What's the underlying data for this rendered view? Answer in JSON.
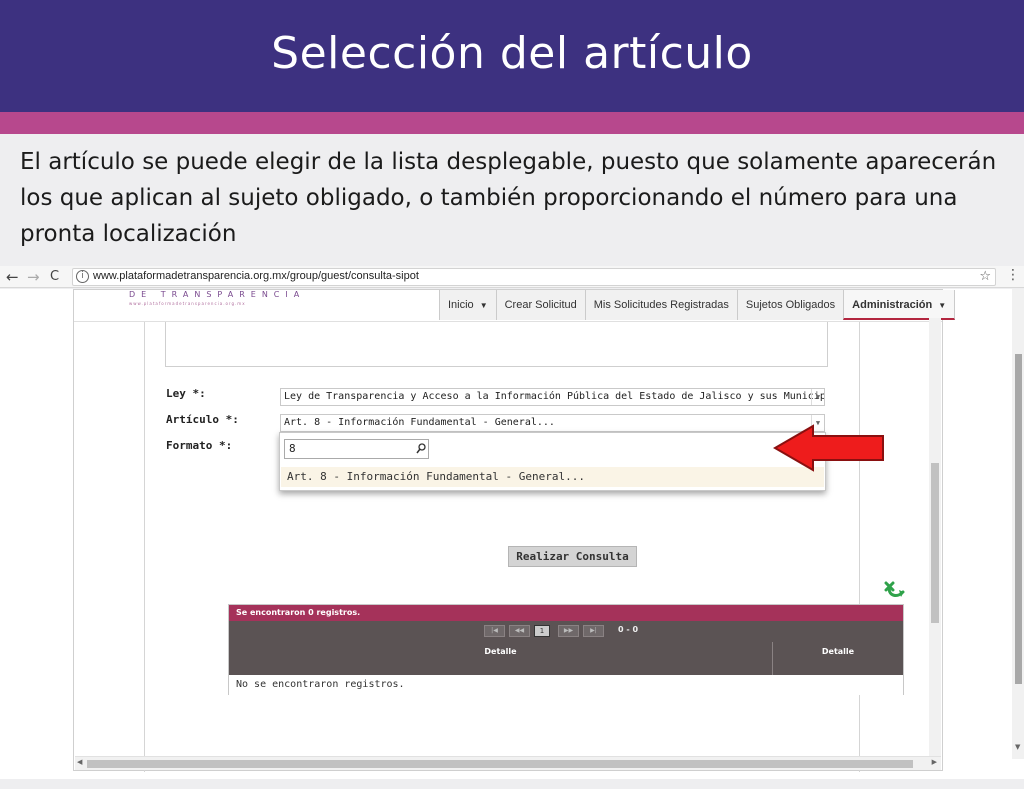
{
  "slide": {
    "title": "Selección del artículo",
    "description": "El artículo se puede elegir de la lista desplegable, puesto que solamente aparecerán los que aplican al sujeto obligado, o también proporcionando el número para una pronta localización"
  },
  "browser": {
    "back": "←",
    "forward": "→",
    "reload": "C",
    "url": "www.plataformadetransparencia.org.mx/group/guest/consulta-sipot",
    "info": "i",
    "star": "☆",
    "menu": "⋮"
  },
  "site": {
    "brand": "DE TRANSPARENCIA",
    "brand_sub": "www.plataformadetransparencia.org.mx"
  },
  "nav": {
    "items": [
      {
        "label": "Inicio"
      },
      {
        "label": "Crear Solicitud"
      },
      {
        "label": "Mis Solicitudes Registradas"
      },
      {
        "label": "Sujetos Obligados"
      },
      {
        "label": "Administración"
      }
    ],
    "caret": "▼"
  },
  "form": {
    "ley_label": "Ley *:",
    "ley_value": "Ley de Transparencia y Acceso a la Información Pública del Estado de Jalisco y sus Municipios",
    "articulo_label": "Artículo *:",
    "articulo_value": "Art. 8 - Información Fundamental - General...",
    "formato_label": "Formato *:",
    "dropdown_search_value": "8",
    "dropdown_option": "Art. 8 - Información Fundamental - General...",
    "submit_label": "Realizar Consulta",
    "select_arrow": "▼"
  },
  "results": {
    "caption": "Se encontraron 0 registros.",
    "pager": {
      "first": "|◀",
      "prev": "◀◀",
      "current": "1",
      "next": "▶▶",
      "last": "▶|",
      "range": "0 - 0"
    },
    "columns": [
      "Detalle",
      "Detalle"
    ],
    "empty": "No se encontraron registros."
  },
  "colors": {
    "header": "#3d3180",
    "band": "#b7488d",
    "grid_caption": "#a5325a",
    "grid_header": "#5b5354",
    "arrow": "#ee1c1c"
  },
  "icons": {
    "search": "search-icon",
    "excel": "excel-export-icon",
    "pointer": "red-arrow-icon"
  }
}
